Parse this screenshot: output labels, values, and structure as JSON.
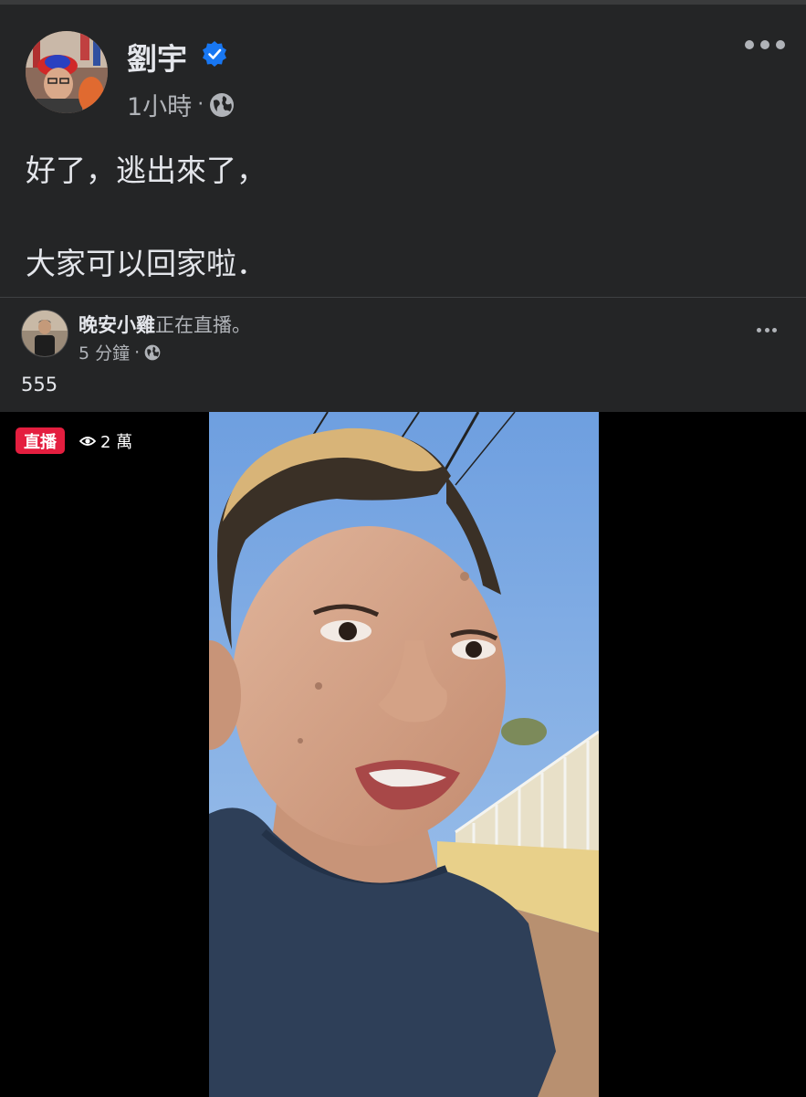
{
  "post": {
    "author": "劉宇",
    "time": "1小時",
    "meta_sep": "·",
    "text_line1": "好了，逃出來了，",
    "text_line2": "大家可以回家啦．"
  },
  "shared": {
    "author": "晚安小雞",
    "status": "正在直播。",
    "time": "5 分鐘",
    "meta_sep": "·",
    "text": "555"
  },
  "video": {
    "live_label": "直播",
    "viewers": "2 萬"
  },
  "colors": {
    "background": "#242526",
    "text": "#e4e6eb",
    "secondary": "#b0b3b8",
    "verified": "#1877f2",
    "live": "#e41e3f"
  },
  "icons": [
    "verified-icon",
    "globe-icon",
    "more-icon",
    "eye-icon"
  ]
}
